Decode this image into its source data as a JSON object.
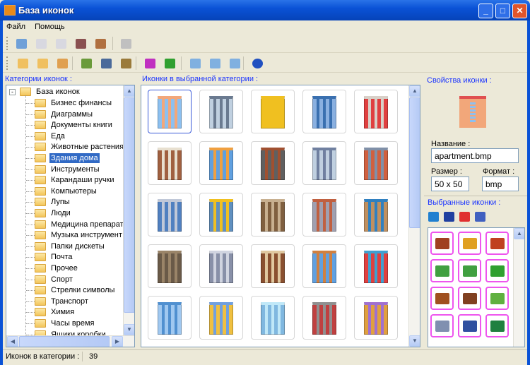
{
  "window": {
    "title": "База иконок"
  },
  "menu": [
    "Файл",
    "Помощь"
  ],
  "toolbar1": [
    {
      "icon": "open-folder-icon",
      "color": "#6fa0d8"
    },
    {
      "icon": "import-icon",
      "color": "#d8d8e0"
    },
    {
      "icon": "export-icon",
      "color": "#d8d8e0"
    },
    {
      "icon": "delete-database-icon",
      "color": "#8a5050"
    },
    {
      "icon": "remove-item-icon",
      "color": "#b07040"
    },
    {
      "icon": "settings-icon",
      "color": "#c0c0c0"
    }
  ],
  "toolbar2": [
    {
      "icon": "add-folder-icon",
      "color": "#f0c060"
    },
    {
      "icon": "edit-folder-icon",
      "color": "#f0c060"
    },
    {
      "icon": "delete-folder-icon",
      "color": "#e0a050"
    },
    {
      "icon": "add-image-icon",
      "color": "#6a9a3a"
    },
    {
      "icon": "save-image-icon",
      "color": "#4a6a9a"
    },
    {
      "icon": "delete-image-icon",
      "color": "#9a7a3a"
    },
    {
      "icon": "select-pointer-icon",
      "color": "#c030c0"
    },
    {
      "icon": "pick-pointer-icon",
      "color": "#30a030"
    },
    {
      "icon": "zoom-out-icon",
      "color": "#80b0e0"
    },
    {
      "icon": "zoom-text-icon",
      "color": "#80b0e0"
    },
    {
      "icon": "zoom-in-icon",
      "color": "#80b0e0"
    },
    {
      "icon": "help-icon",
      "color": "#2050c0"
    }
  ],
  "categories": {
    "title": "Категории иконок :",
    "root": "База иконок",
    "selected_index": 5,
    "items": [
      "Бизнес финансы",
      "Диаграммы",
      "Документы книги",
      "Еда",
      "Животные растения",
      "Здания дома",
      "Инструменты",
      "Карандаши ручки",
      "Компьютеры",
      "Лупы",
      "Люди",
      "Медицина препарат",
      "Музыка инструмент",
      "Папки дискеты",
      "Почта",
      "Прочее",
      "Спорт",
      "Стрелки символы",
      "Транспорт",
      "Химия",
      "Часы время",
      "Ящики коробки"
    ]
  },
  "icons": {
    "title": "Иконки в выбранной категории :",
    "selected_index": 0,
    "items": [
      {
        "name": "apartment-icon",
        "c1": "#f2a77a",
        "c2": "#8cc0f0"
      },
      {
        "name": "office-tower-icon",
        "c1": "#6a7a90",
        "c2": "#c0d0e0"
      },
      {
        "name": "crane-icon",
        "c1": "#f0c020",
        "c2": "#f0c020"
      },
      {
        "name": "city-towers-icon",
        "c1": "#3a70b0",
        "c2": "#8ab0e0"
      },
      {
        "name": "castle-icon",
        "c1": "#d8d0c8",
        "c2": "#e04040"
      },
      {
        "name": "church-icon",
        "c1": "#e8e0d0",
        "c2": "#a06040"
      },
      {
        "name": "skyscrapers-icon",
        "c1": "#f0a040",
        "c2": "#60a0e0"
      },
      {
        "name": "factory-icon",
        "c1": "#a05030",
        "c2": "#606060"
      },
      {
        "name": "tower-icon",
        "c1": "#7080a0",
        "c2": "#c0d0e0"
      },
      {
        "name": "office-block-icon",
        "c1": "#8090a8",
        "c2": "#d06040"
      },
      {
        "name": "store-icon",
        "c1": "#c0c8d8",
        "c2": "#5080c0"
      },
      {
        "name": "construction-icon",
        "c1": "#f0c020",
        "c2": "#6090c0"
      },
      {
        "name": "mansion-icon",
        "c1": "#c8b090",
        "c2": "#806040"
      },
      {
        "name": "factory-chimney-icon",
        "c1": "#c06040",
        "c2": "#a0a0b0"
      },
      {
        "name": "globe-wall-icon",
        "c1": "#3080c0",
        "c2": "#c09060"
      },
      {
        "name": "fortress-icon",
        "c1": "#9a8468",
        "c2": "#6a5a48"
      },
      {
        "name": "capitol-icon",
        "c1": "#d0d4e0",
        "c2": "#8890a8"
      },
      {
        "name": "house-icon",
        "c1": "#e0c8a0",
        "c2": "#8a5030"
      },
      {
        "name": "network-house-icon",
        "c1": "#d08040",
        "c2": "#60a0e0"
      },
      {
        "name": "hospital-icon",
        "c1": "#40a0d0",
        "c2": "#e04040"
      },
      {
        "name": "office-building-icon",
        "c1": "#5090d0",
        "c2": "#a0c8f0"
      },
      {
        "name": "hotel-icon",
        "c1": "#70a0e0",
        "c2": "#f0c040"
      },
      {
        "name": "igloo-icon",
        "c1": "#c0e8f8",
        "c2": "#80b8e0"
      },
      {
        "name": "industrial-plant-icon",
        "c1": "#909090",
        "c2": "#c04040"
      },
      {
        "name": "city-block-icon",
        "c1": "#a070d0",
        "c2": "#e0a040"
      }
    ]
  },
  "properties": {
    "title": "Свойства иконки :",
    "name_label": "Название :",
    "name_value": "apartment.bmp",
    "size_label": "Размер :",
    "size_value": "50 x 50",
    "format_label": "Формат :",
    "format_value": "bmp"
  },
  "favorites": {
    "title": "Выбранные иконки :",
    "tools": [
      {
        "icon": "refresh-icon",
        "color": "#2080d0"
      },
      {
        "icon": "save-icon",
        "color": "#2040a0"
      },
      {
        "icon": "delete-icon",
        "color": "#e03030"
      },
      {
        "icon": "brush-icon",
        "color": "#4060c0"
      }
    ],
    "items": [
      {
        "name": "suitcase-icon",
        "c": "#a04020"
      },
      {
        "name": "scales-icon",
        "c": "#e0a020"
      },
      {
        "name": "bank-icon",
        "c": "#c04020"
      },
      {
        "name": "cards-icon",
        "c": "#40a040"
      },
      {
        "name": "money-icon",
        "c": "#40a040"
      },
      {
        "name": "banknotes-icon",
        "c": "#30a030"
      },
      {
        "name": "briefcase-icon",
        "c": "#a05020"
      },
      {
        "name": "briefcase-money-icon",
        "c": "#804020"
      },
      {
        "name": "cash-stack-icon",
        "c": "#60b040"
      },
      {
        "name": "calculator-icon",
        "c": "#8090b0"
      },
      {
        "name": "phone-icon",
        "c": "#3050a0"
      },
      {
        "name": "cash-register-icon",
        "c": "#208040"
      }
    ]
  },
  "status": {
    "label": "Иконок в категории :",
    "count": "39"
  }
}
